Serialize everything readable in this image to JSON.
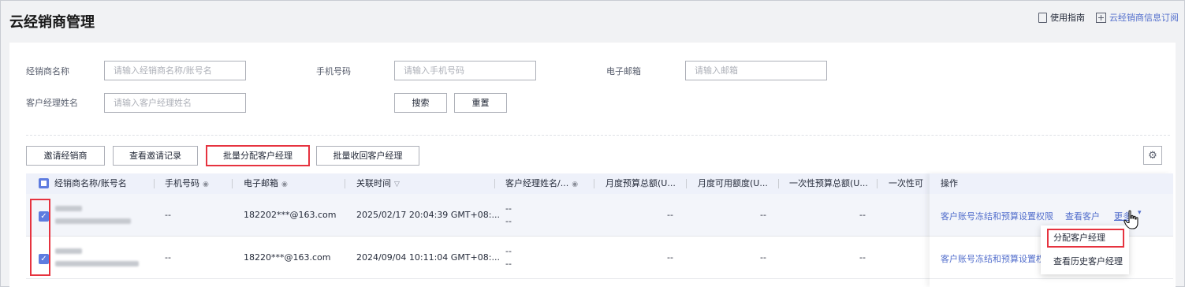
{
  "page_title": "云经销商管理",
  "top_links": {
    "guide": "使用指南",
    "subscribe": "云经销商信息订阅"
  },
  "filters": {
    "dealer_name": {
      "label": "经销商名称",
      "placeholder": "请输入经销商名称/账号名"
    },
    "phone": {
      "label": "手机号码",
      "placeholder": "请输入手机号码"
    },
    "email": {
      "label": "电子邮箱",
      "placeholder": "请输入邮箱"
    },
    "manager": {
      "label": "客户经理姓名",
      "placeholder": "请输入客户经理姓名"
    },
    "search_label": "搜索",
    "reset_label": "重置"
  },
  "toolbar": {
    "invite": "邀请经销商",
    "view_invites": "查看邀请记录",
    "batch_assign": "批量分配客户经理",
    "batch_revoke": "批量收回客户经理"
  },
  "table": {
    "columns": [
      "经销商名称/账号名",
      "手机号码",
      "电子邮箱",
      "关联时间",
      "客户经理姓名/...",
      "月度预算总额(U...",
      "月度可用额度(U...",
      "一次性预算总额(U...",
      "一次性可",
      "操作"
    ],
    "rows": [
      {
        "phone": "--",
        "email": "182202***@163.com",
        "time": "2025/02/17 20:04:39 GMT+08:...",
        "manager_1": "--",
        "manager_2": "--",
        "monthly_budget": "--",
        "monthly_available": "--",
        "one_time_budget": "--"
      },
      {
        "phone": "--",
        "email": "18220***@163.com",
        "time": "2024/09/04 10:11:04 GMT+08:...",
        "manager_1": "--",
        "manager_2": "--",
        "monthly_budget": "--",
        "monthly_available": "--",
        "one_time_budget": "--"
      }
    ],
    "actions": {
      "freeze": "客户账号冻结和预算设置权限",
      "view": "查看客户",
      "more": "更多"
    }
  },
  "more_menu": [
    "分配客户经理",
    "查看历史客户经理"
  ],
  "colors": {
    "accent": "#5e7ce0",
    "link": "#526ecc",
    "highlight": "#e6333f"
  }
}
